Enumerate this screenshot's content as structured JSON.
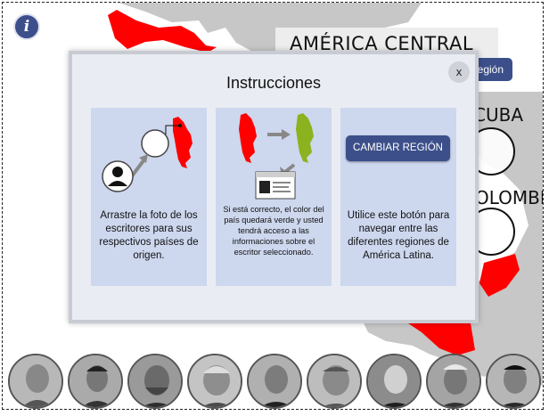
{
  "info_button": {
    "glyph": "i"
  },
  "background": {
    "region_title": "AMÉRICA CENTRAL",
    "region_button_partial": "Región",
    "country_labels": [
      "CUBA",
      "COLOMBIA"
    ],
    "colors": {
      "map_grey": "#c7c7c7",
      "map_red": "#ff0000",
      "accent": "#3c4f8a"
    }
  },
  "modal": {
    "title": "Instrucciones",
    "close_label": "x",
    "cards": [
      {
        "text": "Arrastre la foto de los escritores para sus respectivos países de origen."
      },
      {
        "text": "Si está correcto, el color del país quedará verde y usted tendrá acceso a las informaciones sobre el escritor seleccionado."
      },
      {
        "button_label": "CAMBIAR REGIÓN",
        "text": "Utilice este botón para navegar entre las diferentes regiones de América Latina."
      }
    ],
    "colors": {
      "card_bg": "#cdd7ee",
      "modal_bg": "#e9edf3",
      "country_green": "#8ab31f"
    }
  },
  "portraits": [
    {
      "name": "writer-portrait-1"
    },
    {
      "name": "writer-portrait-2"
    },
    {
      "name": "writer-portrait-3"
    },
    {
      "name": "writer-portrait-4"
    },
    {
      "name": "writer-portrait-5"
    },
    {
      "name": "writer-portrait-6"
    },
    {
      "name": "writer-portrait-7"
    },
    {
      "name": "writer-portrait-8"
    },
    {
      "name": "writer-portrait-9"
    }
  ]
}
